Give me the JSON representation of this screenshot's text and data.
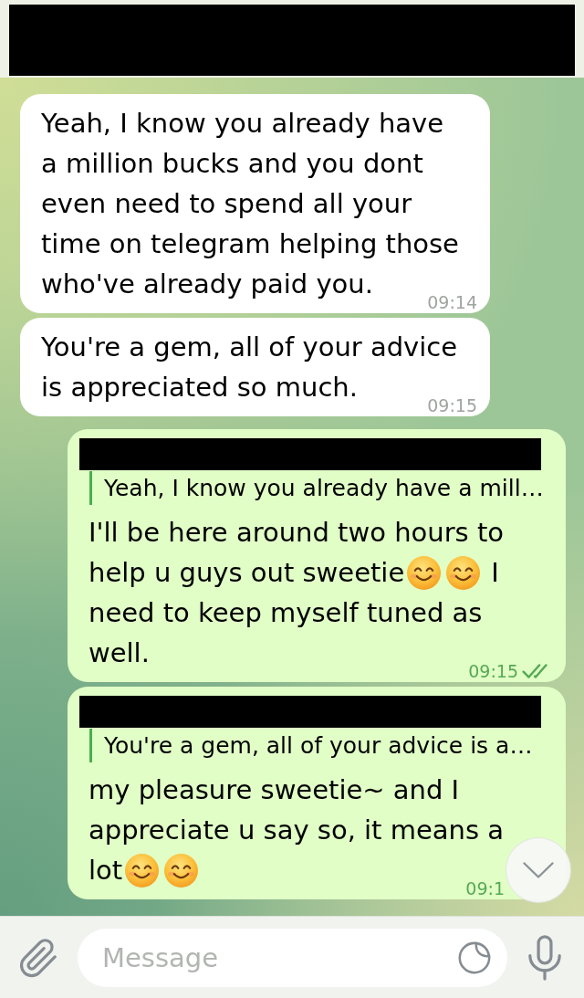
{
  "header": {
    "redacted": true
  },
  "messages": [
    {
      "kind": "incoming",
      "body": [
        {
          "kind": "text",
          "text": "Yeah, I know you already have a million bucks and you dont even need to spend all your time on telegram helping those who've already paid you."
        }
      ],
      "time": "09:14"
    },
    {
      "kind": "incoming",
      "body": [
        {
          "kind": "text",
          "text": "You're a gem, all of your advice is appreciated so much."
        }
      ],
      "time": "09:15"
    },
    {
      "kind": "outgoing",
      "reply": {
        "sender_redacted": true,
        "quote": "Yeah, I know you already have a mill…"
      },
      "body": [
        {
          "kind": "text",
          "text": "I'll be here around two hours to help u guys out sweetie"
        },
        {
          "kind": "emoji"
        },
        {
          "kind": "emoji"
        },
        {
          "kind": "text",
          "text": "I need to keep myself tuned as well."
        }
      ],
      "time": "09:15",
      "read": true
    },
    {
      "kind": "outgoing",
      "reply": {
        "sender_redacted": true,
        "quote": "You're a gem, all of your advice is a…"
      },
      "body": [
        {
          "kind": "text",
          "text": "my pleasure sweetie~ and I appreciate u say so, it means a lot"
        },
        {
          "kind": "emoji"
        },
        {
          "kind": "emoji"
        }
      ],
      "time": "09:1"
    }
  ],
  "composer": {
    "placeholder": "Message"
  }
}
